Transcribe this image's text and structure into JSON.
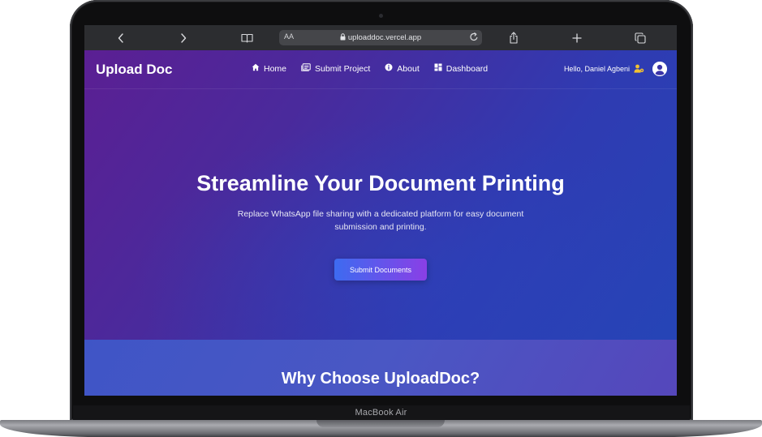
{
  "device": {
    "label": "MacBook Air"
  },
  "browser": {
    "text_size_label": "AA",
    "url": "uploaddoc.vercel.app",
    "icons": [
      "back-icon",
      "forward-icon",
      "bookmarks-icon",
      "lock-icon",
      "reload-icon",
      "share-icon",
      "new-tab-icon",
      "tabs-icon"
    ]
  },
  "navbar": {
    "brand": "Upload Doc",
    "links": [
      {
        "label": "Home",
        "icon": "home-icon"
      },
      {
        "label": "Submit Project",
        "icon": "submit-icon"
      },
      {
        "label": "About",
        "icon": "info-icon"
      },
      {
        "label": "Dashboard",
        "icon": "dashboard-icon"
      }
    ],
    "greeting": "Hello, Daniel Agbeni"
  },
  "hero": {
    "title": "Streamline Your Document Printing",
    "subtitle": "Replace WhatsApp file sharing with a dedicated platform for easy document submission and printing.",
    "cta_label": "Submit Documents"
  },
  "why": {
    "title": "Why Choose UploadDoc?"
  },
  "colors": {
    "gradient_start": "#5b1f93",
    "gradient_end": "#2446b7",
    "cta_start": "#3d6bf0",
    "cta_end": "#8a3fe6"
  }
}
